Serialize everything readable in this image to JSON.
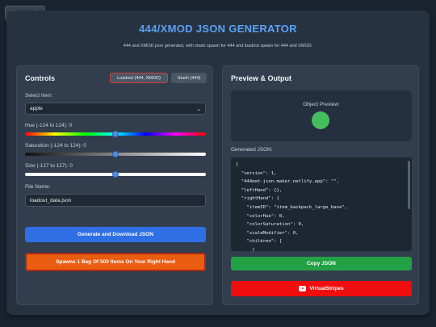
{
  "play_music_label": "Play Music",
  "header": {
    "title": "444/XMOD JSON GENERATOR",
    "subtitle": "444 and XMOD json generator, with stash spawn for 444 and loadout spawn for 444 and XMOD."
  },
  "controls": {
    "title": "Controls",
    "tabs": [
      "Loadout (444, XMOD)",
      "Stash (444)"
    ],
    "select_item_label": "Select Item:",
    "select_item_value": "apple",
    "hue": {
      "label": "Hue (-124 to 124): 0",
      "value": 0,
      "min": -124,
      "max": 124
    },
    "saturation": {
      "label": "Saturation (-124 to 124): 0",
      "value": 0,
      "min": -124,
      "max": 124
    },
    "size": {
      "label": "Size (-127 to 127): 0",
      "value": 0,
      "min": -127,
      "max": 127
    },
    "file_name_label": "File Name:",
    "file_name_value": "loadout_data.json",
    "generate_button": "Generate and Download JSON",
    "spawn_button": "Spawns 1 Bag Of 500 Items On Your Right Hand"
  },
  "preview": {
    "title": "Preview & Output",
    "object_preview_label": "Object Preview:",
    "preview_color": "#46bd5d",
    "generated_json_label": "Generated JSON:",
    "json_lines": [
      "{",
      "  \"version\": 1,",
      "  \"444mat-json-maker.netlify.app\": \"\",",
      "  \"leftHand\": {},",
      "  \"rightHand\": {",
      "    \"itemID\": \"item_backpack_large_base\",",
      "    \"colorHue\": 0,",
      "    \"colorSaturation\": 0,",
      "    \"scaleModifier\": 0,",
      "    \"children\": [",
      "      {"
    ],
    "copy_button": "Copy JSON",
    "youtube_button": "VirtualStripes"
  },
  "colors": {
    "accent": "#5aa2f4",
    "generate": "#2f6fe6",
    "spawn": "#ea5c10",
    "copy": "#23a145",
    "youtube": "#f00d0d"
  }
}
